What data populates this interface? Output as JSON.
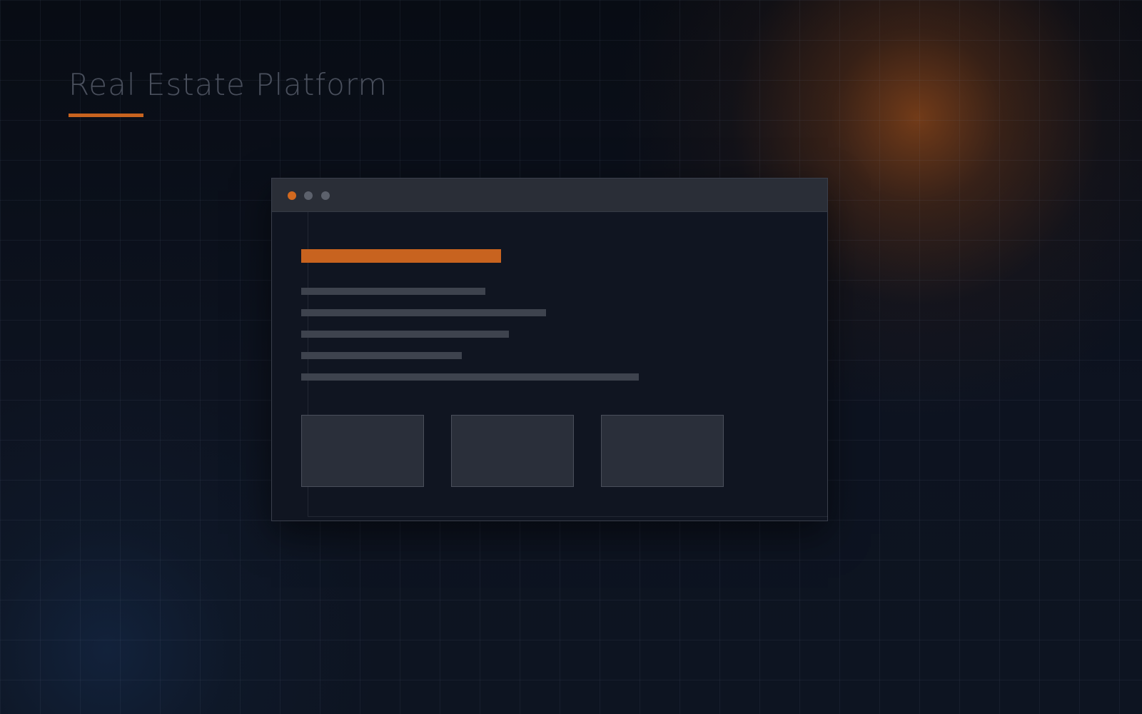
{
  "page": {
    "title": "Real Estate Platform"
  },
  "colors": {
    "accent": "#c8631f",
    "background": "#0c111b",
    "window_body": "#101521",
    "window_titlebar": "#2a2e37",
    "placeholder_line": "#3e434e",
    "placeholder_card": "#2a2f3a",
    "title_text": "#4a505d"
  },
  "browser_window": {
    "controls": [
      {
        "name": "window-control-dot",
        "color": "#d2691f"
      },
      {
        "name": "window-control-dot",
        "color": "#5c616c"
      },
      {
        "name": "window-control-dot",
        "color": "#5c616c"
      }
    ],
    "content": {
      "heading_placeholder_count": 1,
      "text_line_placeholder_count": 5,
      "card_placeholder_count": 3
    }
  }
}
